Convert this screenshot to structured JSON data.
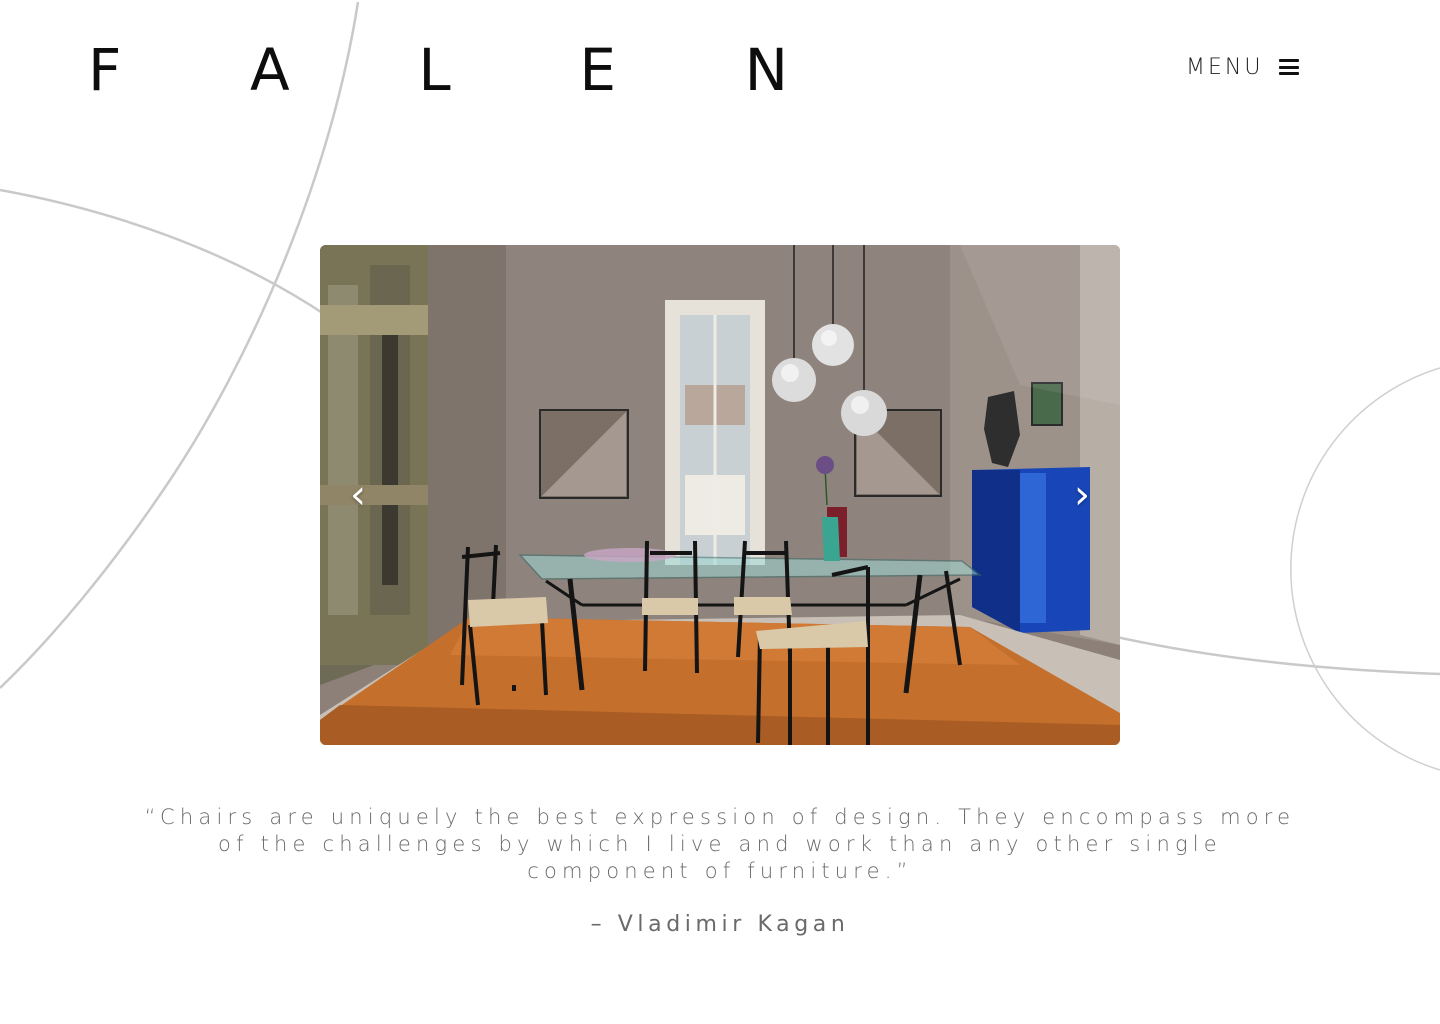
{
  "header": {
    "logo_letters": [
      "F",
      "A",
      "L",
      "E",
      "N"
    ],
    "menu_label": "MENU",
    "menu_icon": "hamburger-menu-icon"
  },
  "slider": {
    "image_label": "dining-room-photo",
    "prev_label": "‹",
    "next_label": "›"
  },
  "quote": {
    "text": "“Chairs are uniquely the best expression of design. They encompass more of the challenges by which I live and work than any other single component of furniture.”",
    "author": "– Vladimir Kagan"
  },
  "colors": {
    "background": "#ffffff",
    "text_dark": "#0d0d0d",
    "text_muted": "#6a6a6a",
    "curve_lines": "#c8c8c8",
    "rug_orange": "#c46f2c",
    "cabinet_blue": "#1846b8"
  }
}
